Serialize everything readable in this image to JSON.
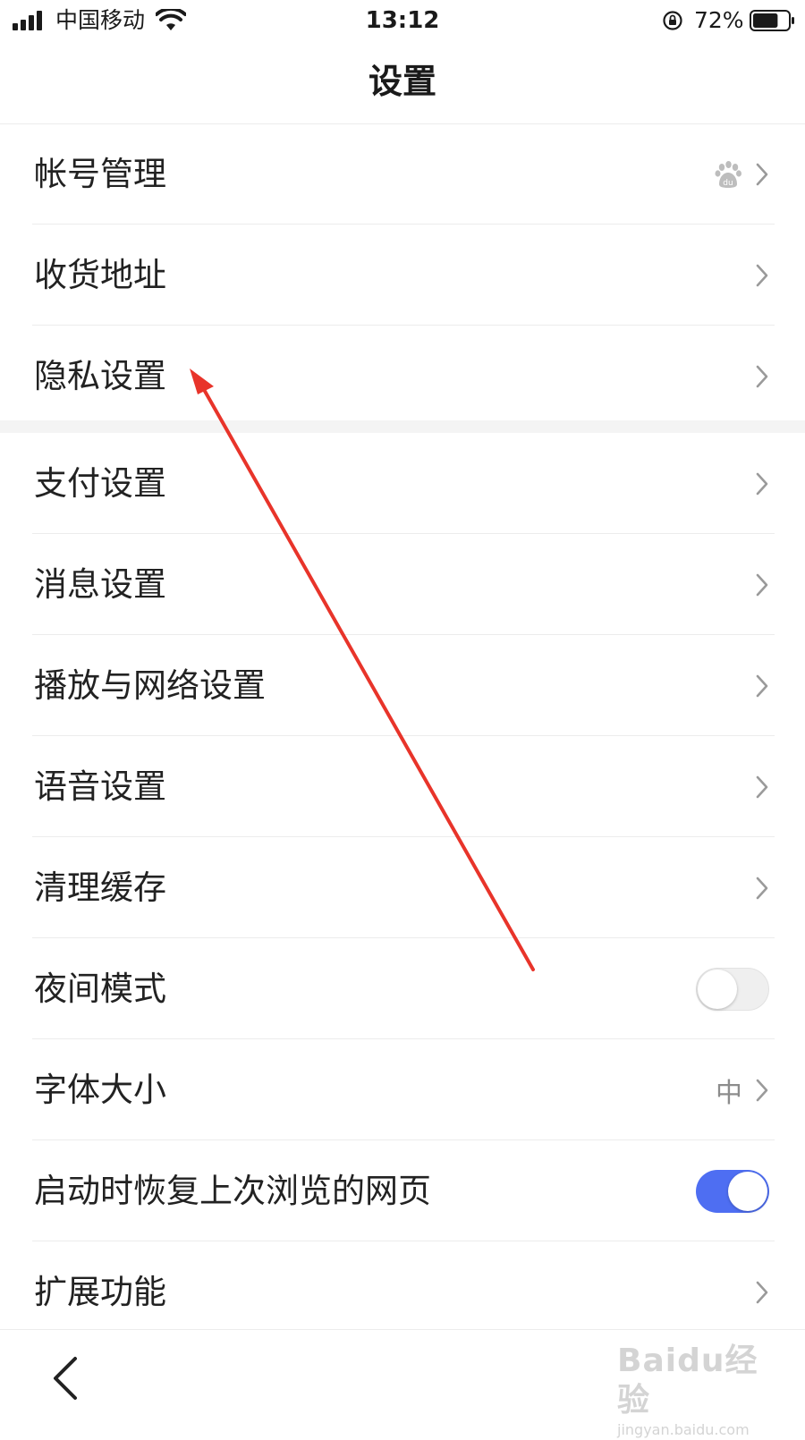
{
  "status_bar": {
    "carrier": "中国移动",
    "time": "13:12",
    "battery_percent": "72%",
    "battery_level": 0.72
  },
  "nav": {
    "title": "设置",
    "back_icon": "chevron-left-icon"
  },
  "groups": [
    {
      "items": [
        {
          "label": "帐号管理",
          "right_icon": "baidu-paw-icon",
          "action": "chevron-right-icon"
        },
        {
          "label": "收货地址",
          "action": "chevron-right-icon"
        },
        {
          "label": "隐私设置",
          "action": "chevron-right-icon"
        }
      ]
    },
    {
      "items": [
        {
          "label": "支付设置",
          "action": "chevron-right-icon"
        },
        {
          "label": "消息设置",
          "action": "chevron-right-icon"
        },
        {
          "label": "播放与网络设置",
          "action": "chevron-right-icon"
        },
        {
          "label": "语音设置",
          "action": "chevron-right-icon"
        },
        {
          "label": "清理缓存",
          "action": "chevron-right-icon"
        },
        {
          "label": "夜间模式",
          "toggle": false
        },
        {
          "label": "字体大小",
          "value": "中",
          "action": "chevron-right-icon"
        },
        {
          "label": "启动时恢复上次浏览的网页",
          "toggle": true
        },
        {
          "label": "扩展功能",
          "action": "chevron-right-icon"
        }
      ]
    }
  ],
  "watermark": {
    "logo": "Baidu经验",
    "url": "jingyan.baidu.com"
  },
  "colors": {
    "toggle_on": "#4e6ef2",
    "annotation_arrow": "#e8342a",
    "divider": "#ececec",
    "chevron": "#9a9a9a"
  }
}
